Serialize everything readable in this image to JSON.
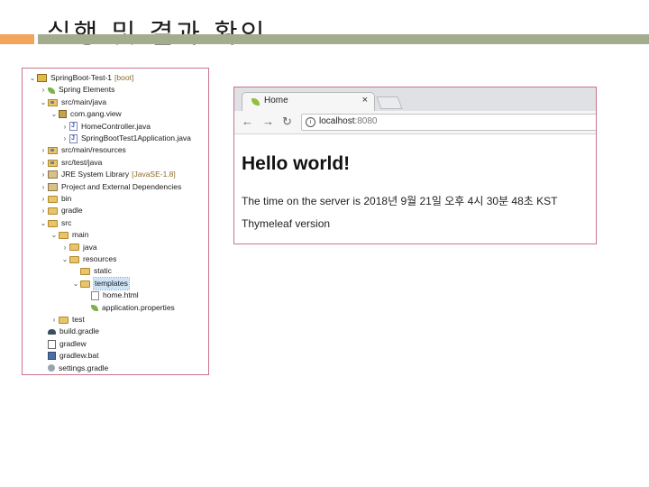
{
  "slide": {
    "title": "실행 및 결과 확인"
  },
  "colors": {
    "accent_orange": "#f4a35a",
    "accent_olive": "#a3ad8e",
    "frame_border": "#c9768a"
  },
  "explorer": {
    "items": [
      {
        "label": "SpringBoot-Test-1",
        "extra": "[boot]",
        "icon": "project-icon",
        "twisty": "expanded"
      },
      {
        "label": "Spring Elements",
        "extra": "",
        "icon": "spring-elements-icon",
        "twisty": "collapsed"
      },
      {
        "label": "src/main/java",
        "extra": "",
        "icon": "source-folder-icon",
        "twisty": "expanded"
      },
      {
        "label": "com.gang.view",
        "extra": "",
        "icon": "package-icon",
        "twisty": "expanded"
      },
      {
        "label": "HomeController.java",
        "extra": "",
        "icon": "java-file-icon",
        "twisty": "collapsed"
      },
      {
        "label": "SpringBootTest1Application.java",
        "extra": "",
        "icon": "java-file-icon",
        "twisty": "collapsed"
      },
      {
        "label": "src/main/resources",
        "extra": "",
        "icon": "source-folder-icon",
        "twisty": "collapsed"
      },
      {
        "label": "src/test/java",
        "extra": "",
        "icon": "source-folder-icon",
        "twisty": "collapsed"
      },
      {
        "label": "JRE System Library",
        "extra": "[JavaSE-1.8]",
        "icon": "library-icon",
        "twisty": "collapsed"
      },
      {
        "label": "Project and External Dependencies",
        "extra": "",
        "icon": "library-icon",
        "twisty": "collapsed"
      },
      {
        "label": "bin",
        "extra": "",
        "icon": "folder-icon",
        "twisty": "collapsed"
      },
      {
        "label": "gradle",
        "extra": "",
        "icon": "folder-icon",
        "twisty": "collapsed"
      },
      {
        "label": "src",
        "extra": "",
        "icon": "folder-icon",
        "twisty": "expanded"
      },
      {
        "label": "main",
        "extra": "",
        "icon": "folder-icon",
        "twisty": "expanded"
      },
      {
        "label": "java",
        "extra": "",
        "icon": "folder-icon",
        "twisty": "collapsed"
      },
      {
        "label": "resources",
        "extra": "",
        "icon": "folder-icon",
        "twisty": "expanded"
      },
      {
        "label": "static",
        "extra": "",
        "icon": "folder-icon",
        "twisty": "none"
      },
      {
        "label": "templates",
        "extra": "",
        "icon": "folder-icon",
        "twisty": "expanded",
        "selected": true
      },
      {
        "label": "home.html",
        "extra": "",
        "icon": "html-file-icon",
        "twisty": "none"
      },
      {
        "label": "application.properties",
        "extra": "",
        "icon": "properties-file-icon",
        "twisty": "none"
      },
      {
        "label": "test",
        "extra": "",
        "icon": "folder-icon",
        "twisty": "collapsed"
      },
      {
        "label": "build.gradle",
        "extra": "",
        "icon": "gradle-file-icon",
        "twisty": "none"
      },
      {
        "label": "gradlew",
        "extra": "",
        "icon": "file-icon",
        "twisty": "none"
      },
      {
        "label": "gradlew.bat",
        "extra": "",
        "icon": "batch-file-icon",
        "twisty": "none"
      },
      {
        "label": "settings.gradle",
        "extra": "",
        "icon": "settings-file-icon",
        "twisty": "none"
      }
    ]
  },
  "browser": {
    "tab_title": "Home",
    "tab_close": "×",
    "nav_back": "←",
    "nav_forward": "→",
    "nav_reload": "↻",
    "info_glyph": "i",
    "url_host": "localhost",
    "url_port": ":8080",
    "heading": "Hello world!",
    "time_text": "The time on the server is 2018년 9월 21일 오후 4시 30분 48초 KST",
    "version_text": "Thymeleaf version"
  }
}
